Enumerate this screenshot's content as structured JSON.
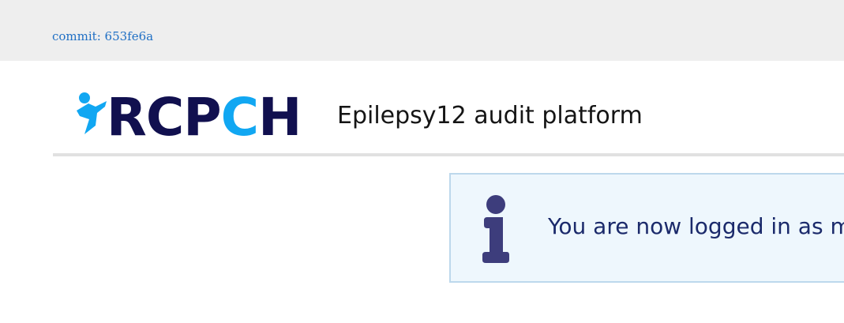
{
  "topbar": {
    "commit_label": "commit: 653fe6a"
  },
  "header": {
    "logo": {
      "text_dark_1": "RCP",
      "text_accent": "C",
      "text_dark_2": "H",
      "icon": "running-figure-icon"
    },
    "title": "Epilepsy12 audit platform"
  },
  "alert": {
    "icon": "info-icon",
    "message": "You are now logged in as m"
  },
  "colors": {
    "topbar_bg": "#eeeeee",
    "link": "#1f6fc4",
    "logo_dark": "#11104f",
    "logo_accent": "#11a7f2",
    "alert_bg": "#eef7fd",
    "alert_border": "#bdd8ec",
    "alert_icon": "#3d3d7c",
    "alert_text": "#1b2a6b"
  }
}
